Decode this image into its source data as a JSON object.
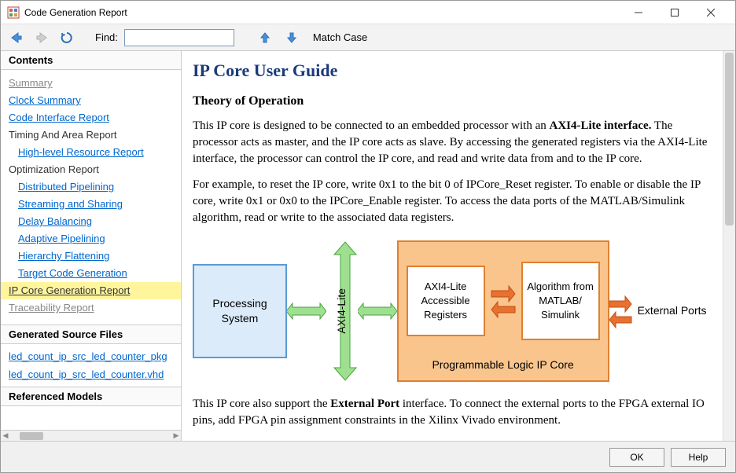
{
  "window": {
    "title": "Code Generation Report"
  },
  "toolbar": {
    "find_label": "Find:",
    "find_value": "",
    "match_case": "Match Case"
  },
  "sidebar": {
    "contents_header": "Contents",
    "items": [
      {
        "label": "Summary",
        "link": true,
        "muted": true
      },
      {
        "label": "Clock Summary",
        "link": true
      },
      {
        "label": "Code Interface Report",
        "link": true
      },
      {
        "label": "Timing And Area Report",
        "link": false
      },
      {
        "label": "High-level Resource Report",
        "link": true,
        "indent": true
      },
      {
        "label": "Optimization Report",
        "link": false
      },
      {
        "label": "Distributed Pipelining",
        "link": true,
        "indent": true
      },
      {
        "label": "Streaming and Sharing",
        "link": true,
        "indent": true
      },
      {
        "label": "Delay Balancing",
        "link": true,
        "indent": true
      },
      {
        "label": "Adaptive Pipelining",
        "link": true,
        "indent": true
      },
      {
        "label": "Hierarchy Flattening",
        "link": true,
        "indent": true
      },
      {
        "label": "Target Code Generation",
        "link": true,
        "indent": true
      },
      {
        "label": "IP Core Generation Report",
        "link": true,
        "selected": true
      },
      {
        "label": "Traceability Report",
        "link": true,
        "muted": true
      }
    ],
    "files_header": "Generated Source Files",
    "files": [
      "led_count_ip_src_led_counter_pkg",
      "led_count_ip_src_led_counter.vhd"
    ],
    "models_header": "Referenced Models"
  },
  "content": {
    "title": "IP Core User Guide",
    "subtitle": "Theory of Operation",
    "para1_a": "This IP core is designed to be connected to an embedded processor with an ",
    "para1_b": "AXI4-Lite interface.",
    "para1_c": " The processor acts as master, and the IP core acts as slave. By accessing the generated registers via the AXI4-Lite interface, the processor can control the IP core, and read and write data from and to the IP core.",
    "para2": "For example, to reset the IP core, write 0x1 to the bit 0 of IPCore_Reset register. To enable or disable the IP core, write 0x1 or 0x0 to the IPCore_Enable register. To access the data ports of the MATLAB/Simulink algorithm, read or write to the associated data registers.",
    "diagram": {
      "proc": "Processing System",
      "axi": "AXI4-Lite",
      "reg": "AXI4-Lite Accessible Registers",
      "algo": "Algorithm from MATLAB/ Simulink",
      "ipcaption": "Programmable Logic IP Core",
      "ext": "External Ports"
    },
    "para3_a": "This IP core also support the ",
    "para3_b": "External Port",
    "para3_c": " interface. To connect the external ports to the FPGA external IO pins, add FPGA pin assignment constraints in the Xilinx Vivado environment."
  },
  "footer": {
    "ok": "OK",
    "help": "Help"
  }
}
